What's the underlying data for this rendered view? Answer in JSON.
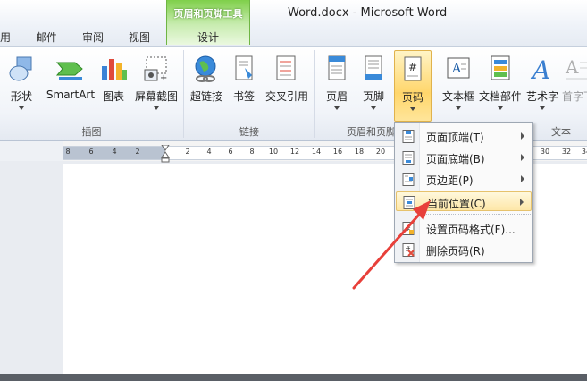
{
  "window": {
    "title": "Word.docx  -  Microsoft Word"
  },
  "tabs": {
    "items": [
      "用",
      "邮件",
      "审阅",
      "视图"
    ],
    "context_group": "页眉和页脚工具",
    "context_tab": "设计"
  },
  "ribbon": {
    "illustrations": {
      "buttons": [
        "形状",
        "SmartArt",
        "图表",
        "屏幕截图"
      ],
      "group_label": "插图"
    },
    "links": {
      "buttons": [
        "超链接",
        "书签",
        "交叉引用"
      ],
      "group_label": "链接"
    },
    "header_footer": {
      "buttons": [
        "页眉",
        "页脚",
        "页码"
      ],
      "group_label": "页眉和页脚",
      "active_button": "页码"
    },
    "text": {
      "buttons": [
        "文本框",
        "文档部件",
        "艺术字",
        "首字下"
      ],
      "group_label": "文本"
    }
  },
  "ruler": {
    "ticks": [
      "8",
      "6",
      "4",
      "2",
      "2",
      "4",
      "6",
      "8",
      "10",
      "12",
      "14",
      "16",
      "18",
      "20",
      "22",
      "24",
      "26",
      "28",
      "30",
      "32",
      "34"
    ]
  },
  "page_number_menu": {
    "items": [
      {
        "label": "页面顶端(T)",
        "submenu": true
      },
      {
        "label": "页面底端(B)",
        "submenu": true
      },
      {
        "label": "页边距(P)",
        "submenu": true
      },
      {
        "label": "当前位置(C)",
        "submenu": true
      },
      {
        "label": "设置页码格式(F)...",
        "submenu": false
      },
      {
        "label": "删除页码(R)",
        "submenu": false
      }
    ],
    "highlighted_item": "当前位置(C)"
  },
  "annotation": {
    "arrow_color": "#e8403a"
  }
}
